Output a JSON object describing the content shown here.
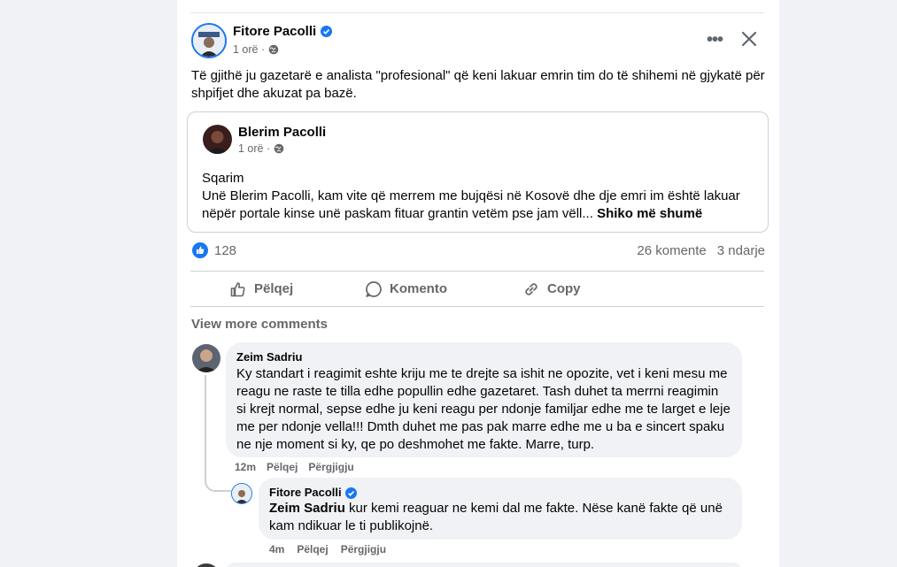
{
  "post": {
    "author": "Fitore Pacolli",
    "time": "1 orë ·",
    "text": "Të gjithë ju gazetarë e analista \"profesional\" që keni lakuar emrin tim do të shihemi në gjykatë për shpifjet dhe akuzat pa bazë.",
    "more_icon": "more-dots-icon",
    "close_icon": "close-icon"
  },
  "shared": {
    "author": "Blerim Pacolli",
    "time": "1 orë ·",
    "text_line1": "Sqarim",
    "text_body": "Unë Blerim Pacolli, kam vite që merrem me bujqësi në Kosovë dhe dje emri im është lakuar nëpër portale kinse unë paskam fituar grantin vetëm pse jam vëll... ",
    "see_more": "Shiko më shumë"
  },
  "stats": {
    "reactions": "128",
    "comments": "26 komente",
    "shares": "3 ndarje"
  },
  "actions": {
    "like": "Pëlqej",
    "comment": "Komento",
    "share": "Copy"
  },
  "comments": {
    "view_more": "View more comments",
    "c1": {
      "name": "Zeim Sadriu",
      "text": "Ky standart i reagimit eshte kriju me te drejte sa ishit ne opozite, vet i keni mesu me reagu ne raste te tilla edhe popullin edhe gazetaret. Tash duhet ta merrni reagimin si krejt normal, sepse edhe ju keni reagu per ndonje familjar edhe me te larget e leje me per ndonje vella!!! Dmth duhet me pas pak marre edhe me u ba e sincert spaku ne nje moment si ky, qe po deshmohet me fakte. Marre, turp.",
      "time": "12m",
      "like": "Pëlqej",
      "reply": "Përgjigju"
    },
    "r1": {
      "name": "Fitore Pacolli",
      "mention": "Zeim Sadriu",
      "text": " kur kemi reaguar ne kemi dal me fakte. Nëse kanë fakte që unë kam ndikuar le ti publikojnë.",
      "time": "4m",
      "like": "Pëlqej",
      "reply": "Përgjigju"
    }
  },
  "colors": {
    "accent": "#1877f2",
    "muted": "#65676b",
    "bubble": "#f0f2f5"
  }
}
